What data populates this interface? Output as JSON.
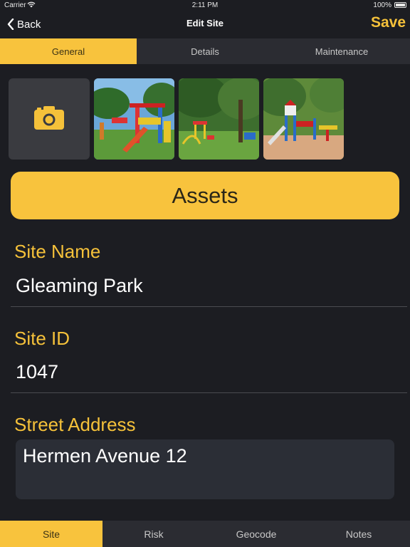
{
  "status_bar": {
    "carrier": "Carrier",
    "time": "2:11 PM",
    "battery": "100%"
  },
  "nav": {
    "back_label": "Back",
    "title": "Edit Site",
    "save_label": "Save"
  },
  "top_tabs": [
    {
      "label": "General",
      "active": true
    },
    {
      "label": "Details",
      "active": false
    },
    {
      "label": "Maintenance",
      "active": false
    }
  ],
  "photos": {
    "add_icon": "camera-icon",
    "count": 3
  },
  "assets_button": "Assets",
  "fields": {
    "site_name": {
      "label": "Site Name",
      "value": "Gleaming Park"
    },
    "site_id": {
      "label": "Site ID",
      "value": "1047"
    },
    "street_address": {
      "label": "Street Address",
      "value": "Hermen Avenue 12"
    }
  },
  "bottom_tabs": [
    {
      "label": "Site",
      "active": true
    },
    {
      "label": "Risk",
      "active": false
    },
    {
      "label": "Geocode",
      "active": false
    },
    {
      "label": "Notes",
      "active": false
    }
  ],
  "colors": {
    "accent": "#f8c33d",
    "background": "#1c1d22",
    "label": "#f5c13a"
  }
}
